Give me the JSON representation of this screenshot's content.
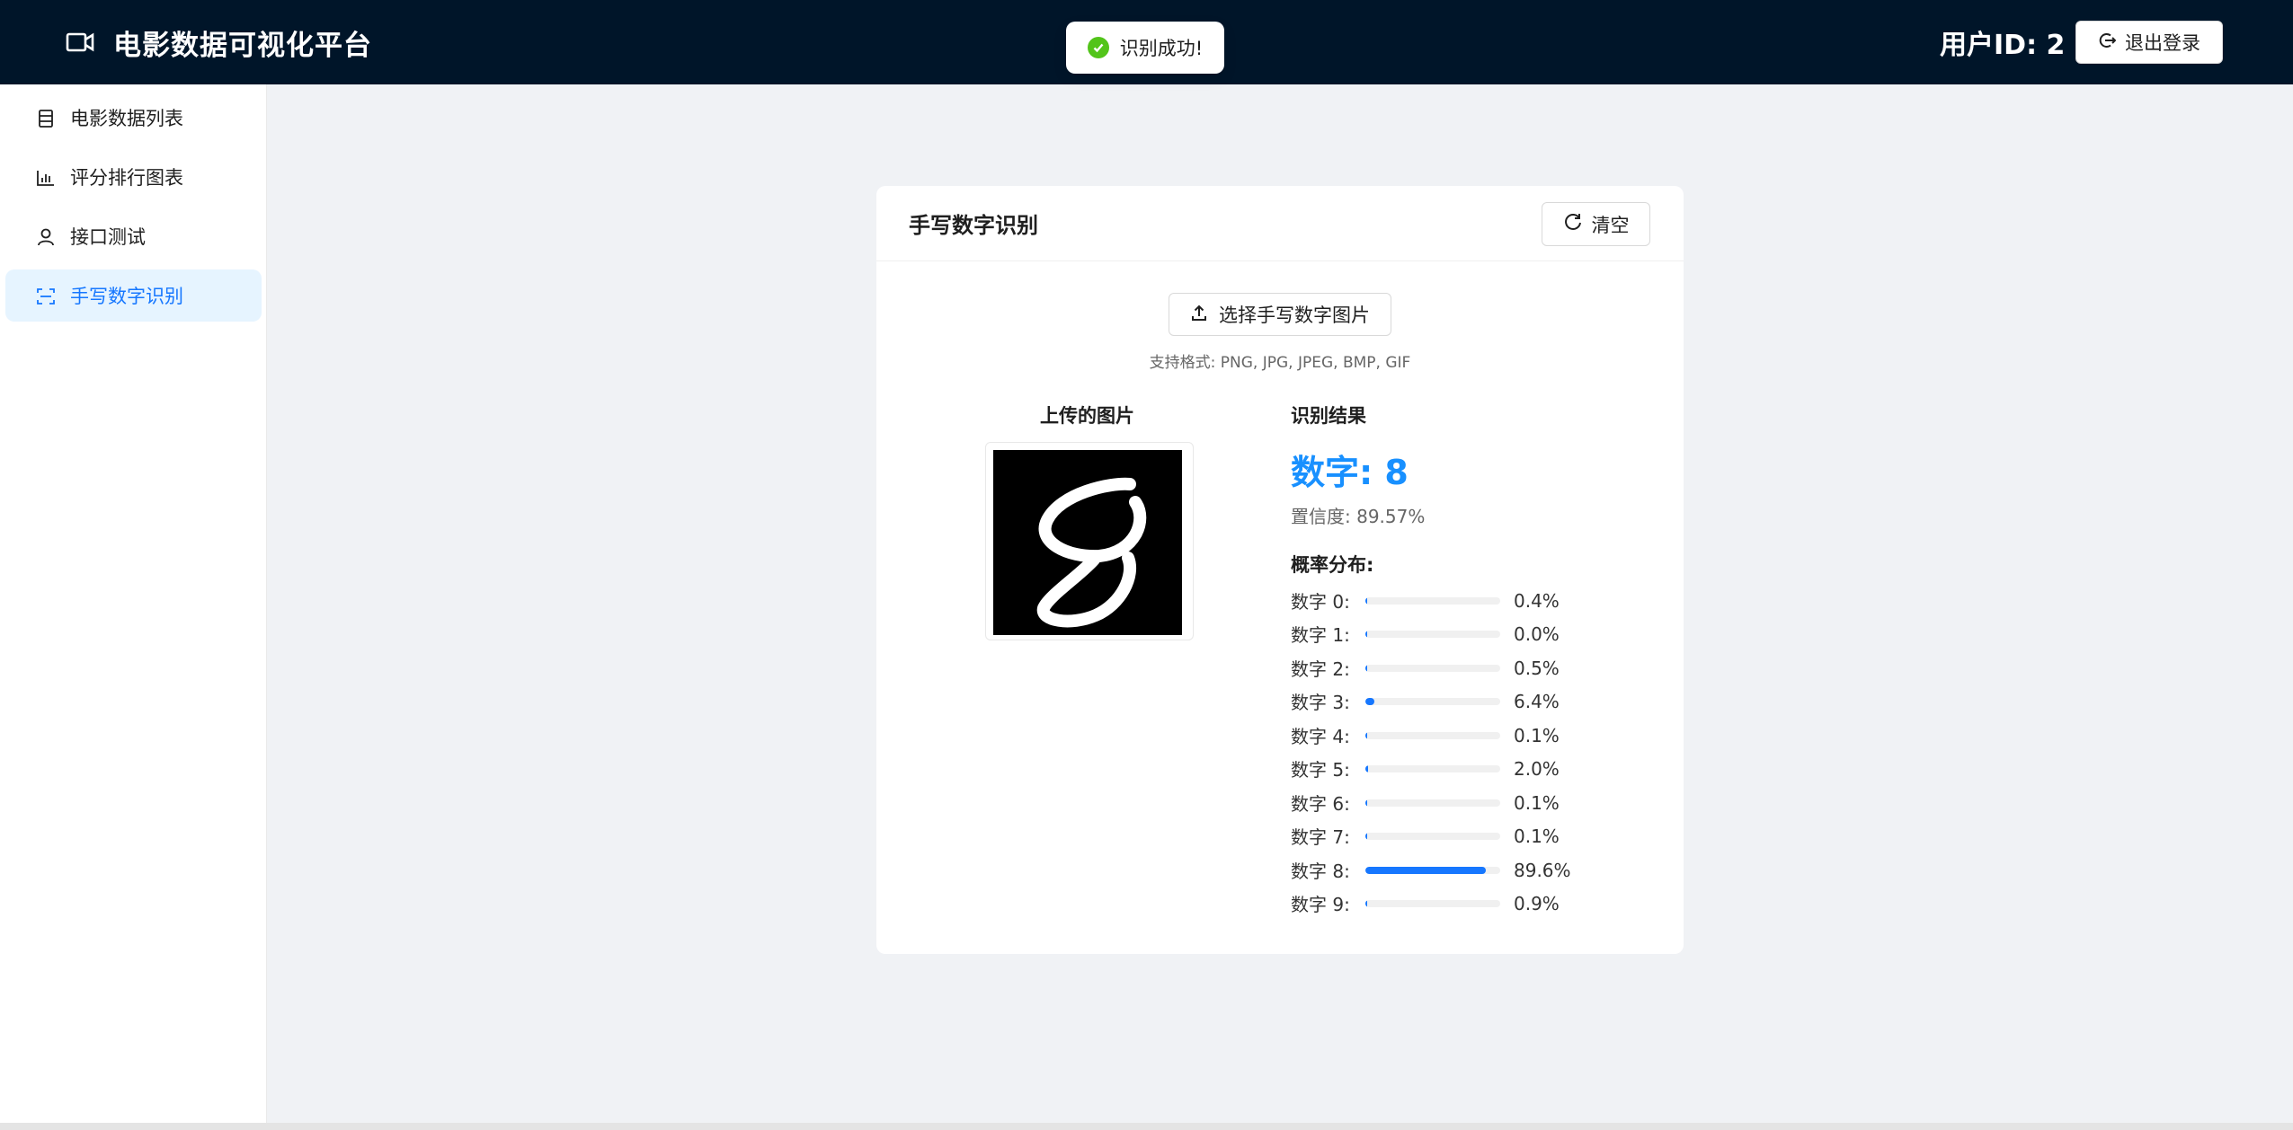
{
  "header": {
    "title": "电影数据可视化平台",
    "user_id_label": "用户ID: 2",
    "logout_label": "退出登录"
  },
  "toast": {
    "message": "识别成功!"
  },
  "sidebar": {
    "items": [
      {
        "label": "电影数据列表",
        "icon": "table-icon",
        "active": false
      },
      {
        "label": "评分排行图表",
        "icon": "bar-chart-icon",
        "active": false
      },
      {
        "label": "接口测试",
        "icon": "user-icon",
        "active": false
      },
      {
        "label": "手写数字识别",
        "icon": "scan-icon",
        "active": true
      }
    ]
  },
  "card": {
    "title": "手写数字识别",
    "clear_label": "清空",
    "upload_label": "选择手写数字图片",
    "formats": "支持格式: PNG, JPG, JPEG, BMP, GIF",
    "uploaded_label": "上传的图片",
    "result_label": "识别结果",
    "result_digit": "数字: 8",
    "confidence": "置信度: 89.57%",
    "distribution_label": "概率分布:",
    "probabilities": [
      {
        "label": "数字 0:",
        "value": "0.4%",
        "fraction": 0.004
      },
      {
        "label": "数字 1:",
        "value": "0.0%",
        "fraction": 0.0
      },
      {
        "label": "数字 2:",
        "value": "0.5%",
        "fraction": 0.005
      },
      {
        "label": "数字 3:",
        "value": "6.4%",
        "fraction": 0.064
      },
      {
        "label": "数字 4:",
        "value": "0.1%",
        "fraction": 0.001
      },
      {
        "label": "数字 5:",
        "value": "2.0%",
        "fraction": 0.02
      },
      {
        "label": "数字 6:",
        "value": "0.1%",
        "fraction": 0.001
      },
      {
        "label": "数字 7:",
        "value": "0.1%",
        "fraction": 0.001
      },
      {
        "label": "数字 8:",
        "value": "89.6%",
        "fraction": 0.896
      },
      {
        "label": "数字 9:",
        "value": "0.9%",
        "fraction": 0.009
      }
    ]
  },
  "colors": {
    "header_bg": "#001529",
    "accent": "#1677ff",
    "result_digit": "#1890ff",
    "success": "#52c41a"
  }
}
